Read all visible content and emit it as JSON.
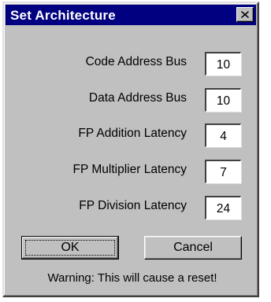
{
  "dialog": {
    "title": "Set Architecture",
    "close_icon": "close-x-icon"
  },
  "fields": [
    {
      "label": "Code Address Bus",
      "value": "10"
    },
    {
      "label": "Data Address Bus",
      "value": "10"
    },
    {
      "label": "FP Addition Latency",
      "value": "4"
    },
    {
      "label": "FP Multiplier Latency",
      "value": "7"
    },
    {
      "label": "FP Division Latency",
      "value": "24"
    }
  ],
  "buttons": {
    "ok_label": "OK",
    "cancel_label": "Cancel"
  },
  "warning": "Warning: This will cause a reset!",
  "colors": {
    "titlebar": "#000080",
    "face": "#c0c0c0"
  }
}
